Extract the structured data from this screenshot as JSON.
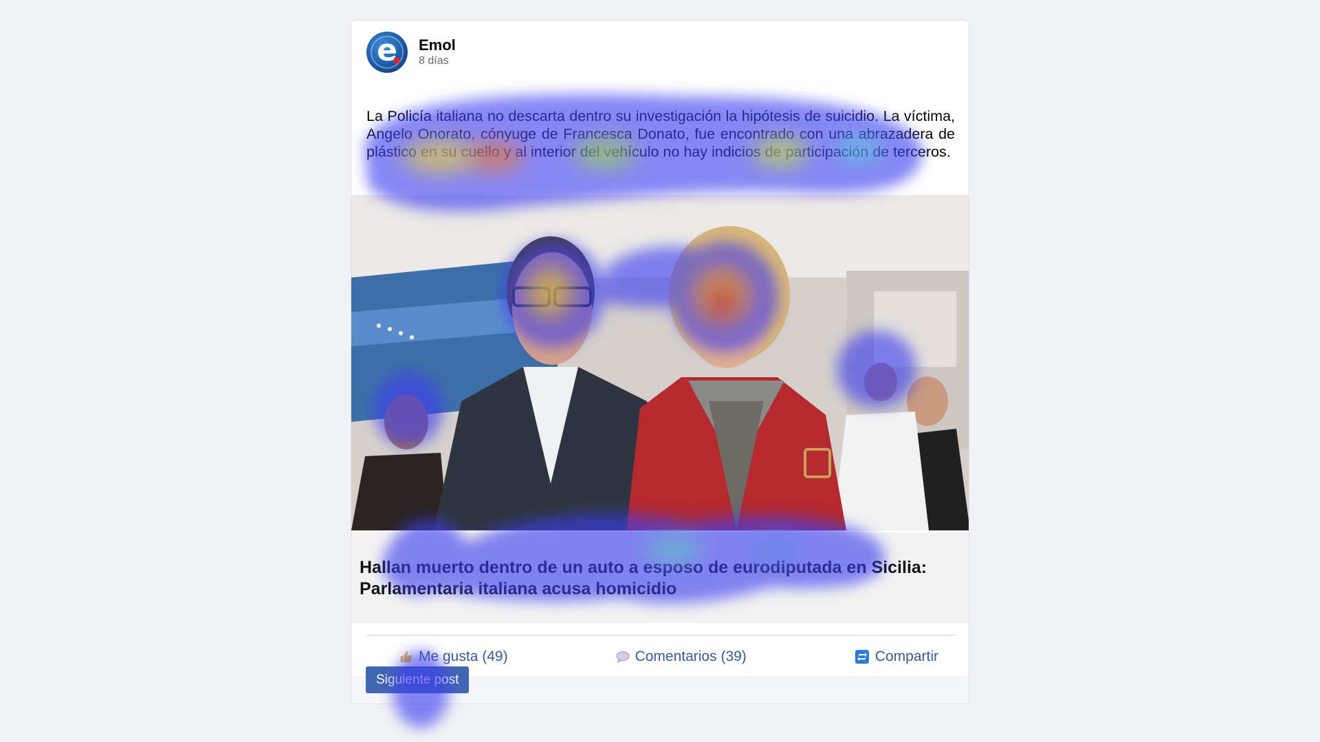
{
  "post": {
    "author": "Emol",
    "time": "8 días",
    "avatar_letter": "e",
    "text": "La Policía italiana no descarta dentro su investigación la hipótesis de suicidio. La víctima, Angelo Onorato, cónyuge de Francesca Donato, fue encontrado con una abrazadera de plástico en su cuello y al interior del vehículo no hay indicios de participación de terceros.",
    "link_title": "Hallan muerto dentro de un auto a esposo de eurodiputada en Sicilia: Parlamentaria italiana acusa homicidio"
  },
  "actions": {
    "like_label": "Me gusta (49)",
    "comments_label": "Comentarios (39)",
    "share_label": "Compartir"
  },
  "footer": {
    "next_label": "Siguiente post"
  },
  "icons": {
    "like": "thumbs-up-icon",
    "comments": "speech-bubble-icon",
    "share": "share-icon"
  },
  "colors": {
    "link_blue": "#385898",
    "button_blue": "#4267b2",
    "background": "#f0f2f5",
    "brand_blue": "#1a5aa8",
    "brand_red": "#e0252c"
  }
}
